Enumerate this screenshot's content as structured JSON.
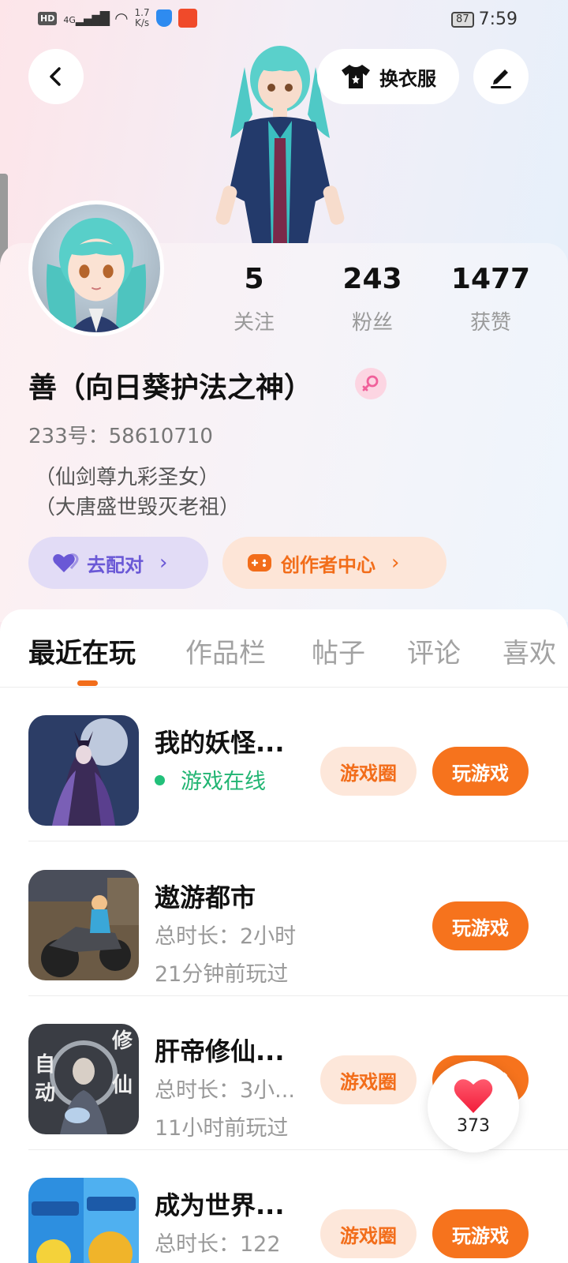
{
  "status_bar": {
    "hd": "HD",
    "signal": "4G",
    "speed_top": "1.7",
    "speed_bottom": "K/s",
    "battery": "87",
    "time": "7:59"
  },
  "header": {
    "back_icon": "back-arrow-icon",
    "dress_label": "换衣服",
    "edit_icon": "edit-pen-icon"
  },
  "profile": {
    "stats": [
      {
        "value": "5",
        "label": "关注"
      },
      {
        "value": "243",
        "label": "粉丝"
      },
      {
        "value": "1477",
        "label": "获赞"
      }
    ],
    "nickname": "善（向日葵护法之神）",
    "gender_icon": "female-icon",
    "uid": "233号：58610710",
    "bio_line1": "（仙剑尊九彩圣女）",
    "bio_line2": "（大唐盛世毁灭老祖）",
    "match_label": "去配对",
    "creator_label": "创作者中心",
    "colors": {
      "match": "#6a58d6",
      "creator": "#f26d1a"
    }
  },
  "tabs": [
    "最近在玩",
    "作品栏",
    "帖子",
    "评论",
    "喜欢"
  ],
  "games": [
    {
      "name": "我的妖怪...",
      "status": "游戏在线",
      "circle_label": "游戏圈",
      "play_label": "玩游戏"
    },
    {
      "name": "遨游都市",
      "duration": "总时长：2小时",
      "last_played": "21分钟前玩过",
      "play_label": "玩游戏"
    },
    {
      "name": "肝帝修仙...",
      "duration": "总时长：3小...",
      "last_played": "11小时前玩过",
      "circle_label": "游戏圈",
      "play_label": "玩游戏"
    },
    {
      "name": "成为世界...",
      "duration": "总时长：122",
      "circle_label": "游戏圈",
      "play_label": "玩游戏"
    }
  ],
  "like_fab": {
    "count": "373",
    "icon": "heart-icon"
  },
  "accent": "#f6731d"
}
